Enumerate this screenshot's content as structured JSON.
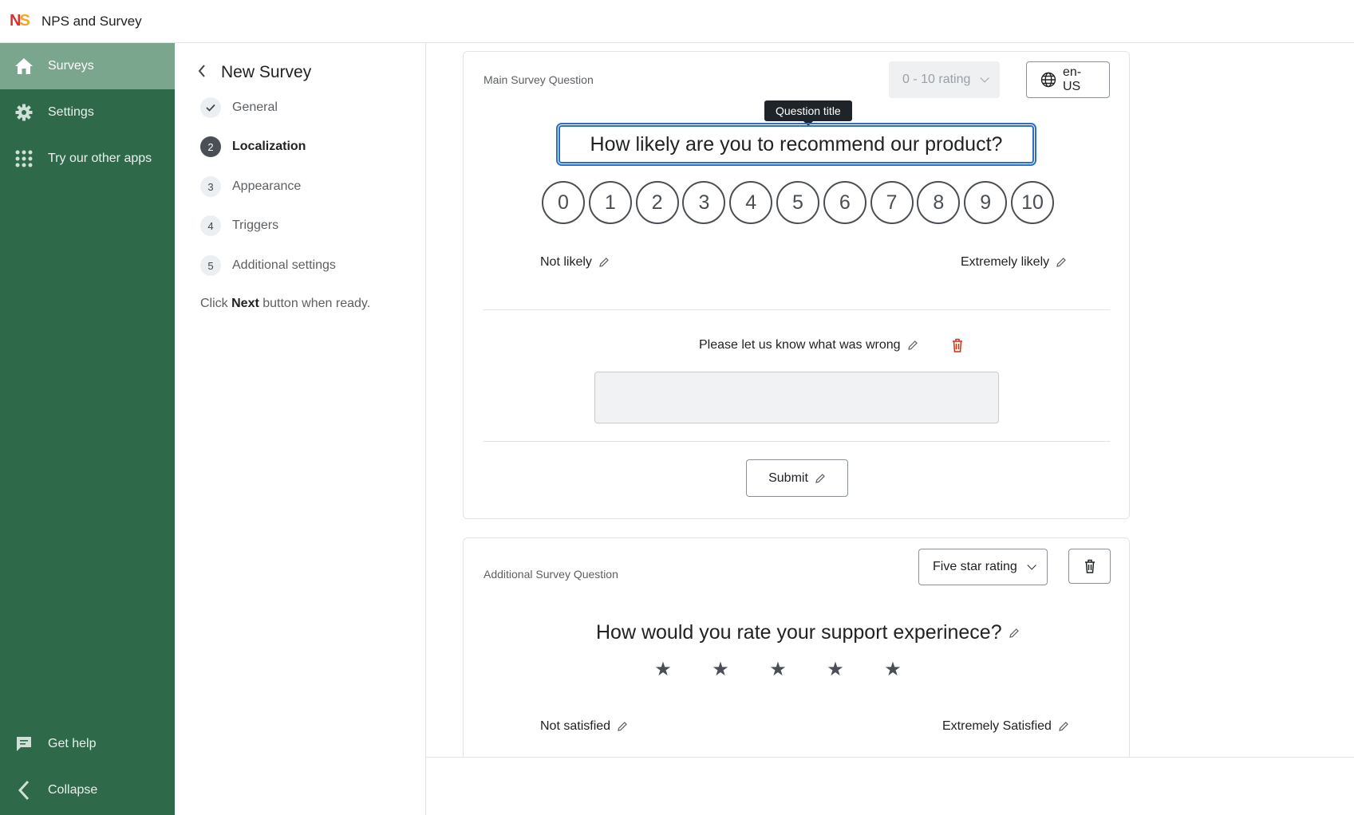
{
  "app": {
    "title": "NPS and Survey",
    "logo_n": "N",
    "logo_s": "S"
  },
  "sidebar": {
    "items": [
      {
        "label": "Surveys",
        "icon": "home-icon"
      },
      {
        "label": "Settings",
        "icon": "gear-icon"
      },
      {
        "label": "Try our other apps",
        "icon": "apps-grid-icon"
      }
    ],
    "bottom": [
      {
        "label": "Get help",
        "icon": "chat-icon"
      },
      {
        "label": "Collapse",
        "icon": "chevron-left-icon"
      }
    ]
  },
  "steps": {
    "title": "New Survey",
    "items": [
      {
        "num": "✓",
        "label": "General",
        "state": "done"
      },
      {
        "num": "2",
        "label": "Localization",
        "state": "current"
      },
      {
        "num": "3",
        "label": "Appearance",
        "state": "pending"
      },
      {
        "num": "4",
        "label": "Triggers",
        "state": "pending"
      },
      {
        "num": "5",
        "label": "Additional settings",
        "state": "pending"
      }
    ],
    "hint_pre": "Click ",
    "hint_bold": "Next",
    "hint_post": " button when ready."
  },
  "main_question": {
    "label": "Main Survey Question",
    "type_select": "0 - 10 rating",
    "locale": "en-US",
    "tooltip": "Question title",
    "title": "How likely are you to recommend our product?",
    "scale": [
      "0",
      "1",
      "2",
      "3",
      "4",
      "5",
      "6",
      "7",
      "8",
      "9",
      "10"
    ],
    "low_label": "Not likely",
    "high_label": "Extremely likely",
    "followup_prompt": "Please let us know what was wrong",
    "submit_label": "Submit"
  },
  "additional_question": {
    "label": "Additional Survey Question",
    "type_select": "Five star rating",
    "title": "How would you rate your support experinece?",
    "star_count": 5,
    "low_label": "Not satisfied",
    "high_label": "Extremely Satisfied"
  },
  "colors": {
    "sidebar": "#2e6a4a",
    "sidebar_active": "#7aa68d",
    "focus": "#2c6ecb",
    "danger": "#d72c0d"
  }
}
